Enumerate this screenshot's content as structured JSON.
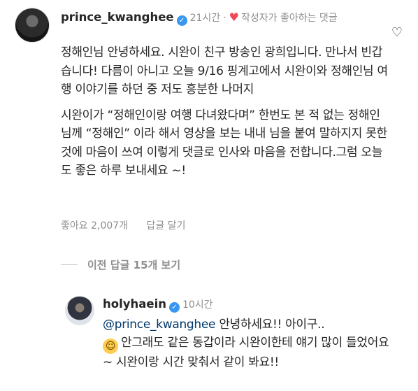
{
  "comment1": {
    "username": "prince_kwanghee",
    "verified_mark": "✓",
    "time": "21시간",
    "dot": "·",
    "liked_by_author": "작성자가 좋아하는 댓글",
    "paragraph1": "정해인님 안녕하세요. 시완이 친구 방송인 광희입니다. 만나서 빈갑습니다! 다름이 아니고 오늘 9/16 핑계고에서 시완이와 정해인님 여행 이야기를 하던 중 저도 흥분한 나머지",
    "paragraph2": "시완이가 “정해인이랑 여행 다녀왔다며” 한번도 본 적 없는 정해인님께 “정해인” 이라 해서 영상을 보는 내내 님을 붙여 말하지지 못한것에 마음이 쓰여 이렇게 댓글로 인사와 마음을 전합니다.그럼 오늘도 좋은 하루 보내세요 ~!",
    "likes": "좋아요 2,007개",
    "reply_label": "답글 달기",
    "like_icon": "heart-outline"
  },
  "previous_replies": {
    "label": "이전 답글 15개 보기"
  },
  "comment2": {
    "username": "holyhaein",
    "verified_mark": "✓",
    "time": "10시간",
    "mention": "@prince_kwanghee",
    "text_after_mention": " 안녕하세요!! 아이구..",
    "emoji": "sweat-smile-emoji",
    "text_rest": "안그래도 같은 동갑이라 시완이한테 얘기 많이 들었어요~ 시완이랑 시간 맞춰서 같이 봐요!!"
  },
  "colors": {
    "verified": "#3897f0",
    "liked_heart": "#ed4956",
    "mention": "#00376b",
    "muted_text": "#8e8e8e"
  }
}
